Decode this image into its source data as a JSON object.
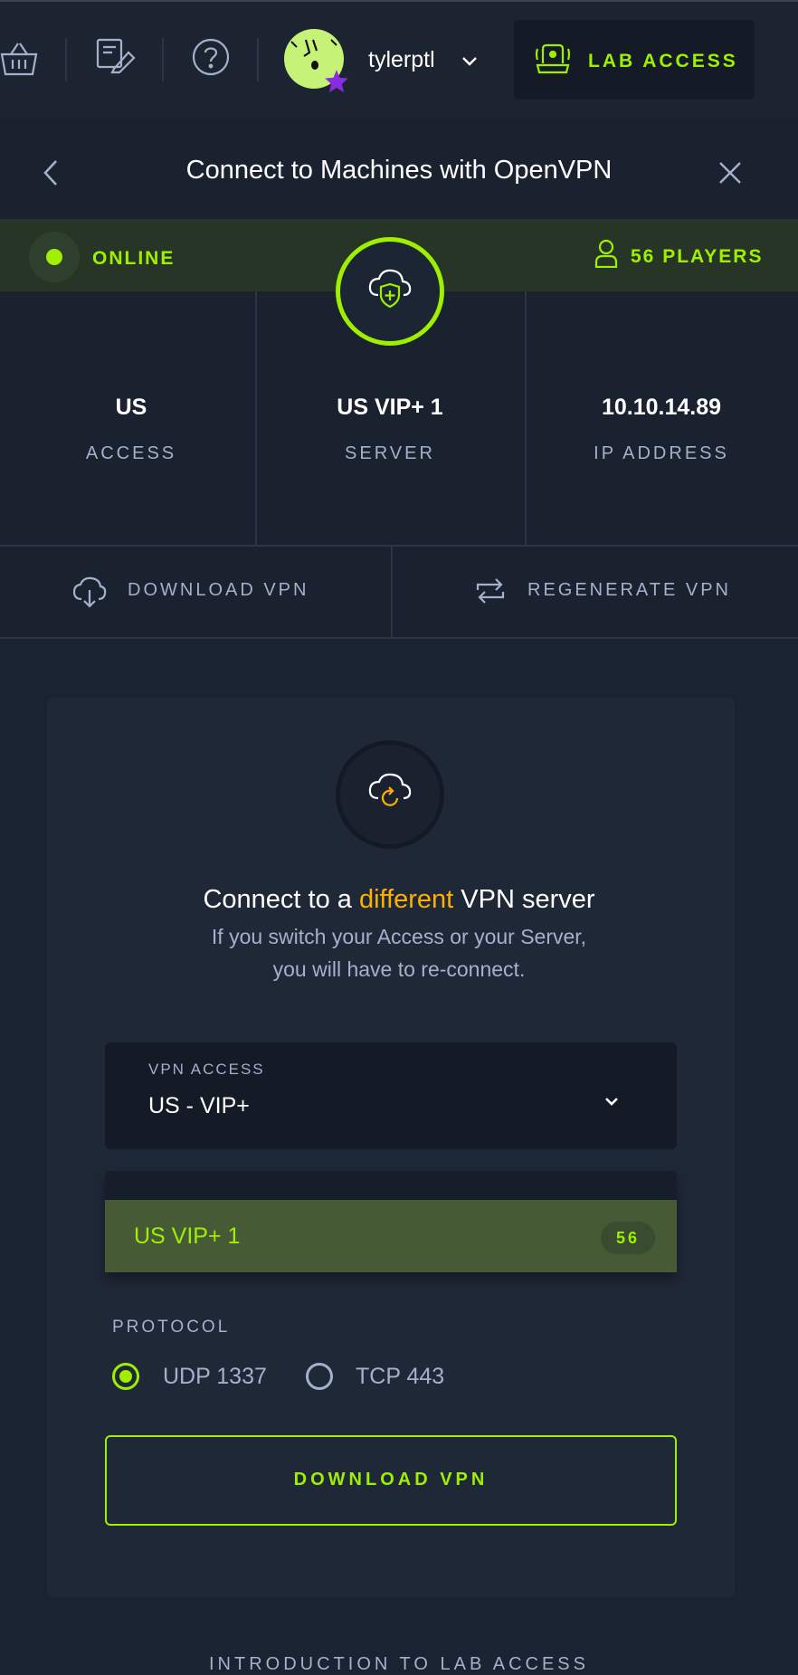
{
  "topbar": {
    "username": "tylerptl",
    "lab_access_label": "LAB ACCESS"
  },
  "header": {
    "title": "Connect to Machines with OpenVPN"
  },
  "status": {
    "online_label": "ONLINE",
    "players_label": "56 PLAYERS"
  },
  "stats": [
    {
      "value": "US",
      "label": "ACCESS"
    },
    {
      "value": "US VIP+ 1",
      "label": "SERVER"
    },
    {
      "value": "10.10.14.89",
      "label": "IP ADDRESS"
    }
  ],
  "actions": {
    "download_label": "DOWNLOAD VPN",
    "regenerate_label": "REGENERATE VPN"
  },
  "panel": {
    "heading_prefix": "Connect to a ",
    "heading_highlight": "different",
    "heading_suffix": " VPN server",
    "subtitle_line1": "If you switch your Access or your Server,",
    "subtitle_line2": "you will have to re-connect.",
    "vpn_access_label": "VPN ACCESS",
    "vpn_access_value": "US - VIP+",
    "server_option_name": "US VIP+ 1",
    "server_option_count": "56",
    "protocol_label": "PROTOCOL",
    "protocol_options": [
      "UDP 1337",
      "TCP 443"
    ],
    "protocol_selected": "UDP 1337",
    "download_button_label": "DOWNLOAD VPN"
  },
  "footer": {
    "intro_link": "INTRODUCTION TO LAB ACCESS"
  },
  "colors": {
    "accent": "#9fef00",
    "highlight": "#ffaf00",
    "muted_text": "#a4b1cd",
    "background": "#1a2332"
  }
}
